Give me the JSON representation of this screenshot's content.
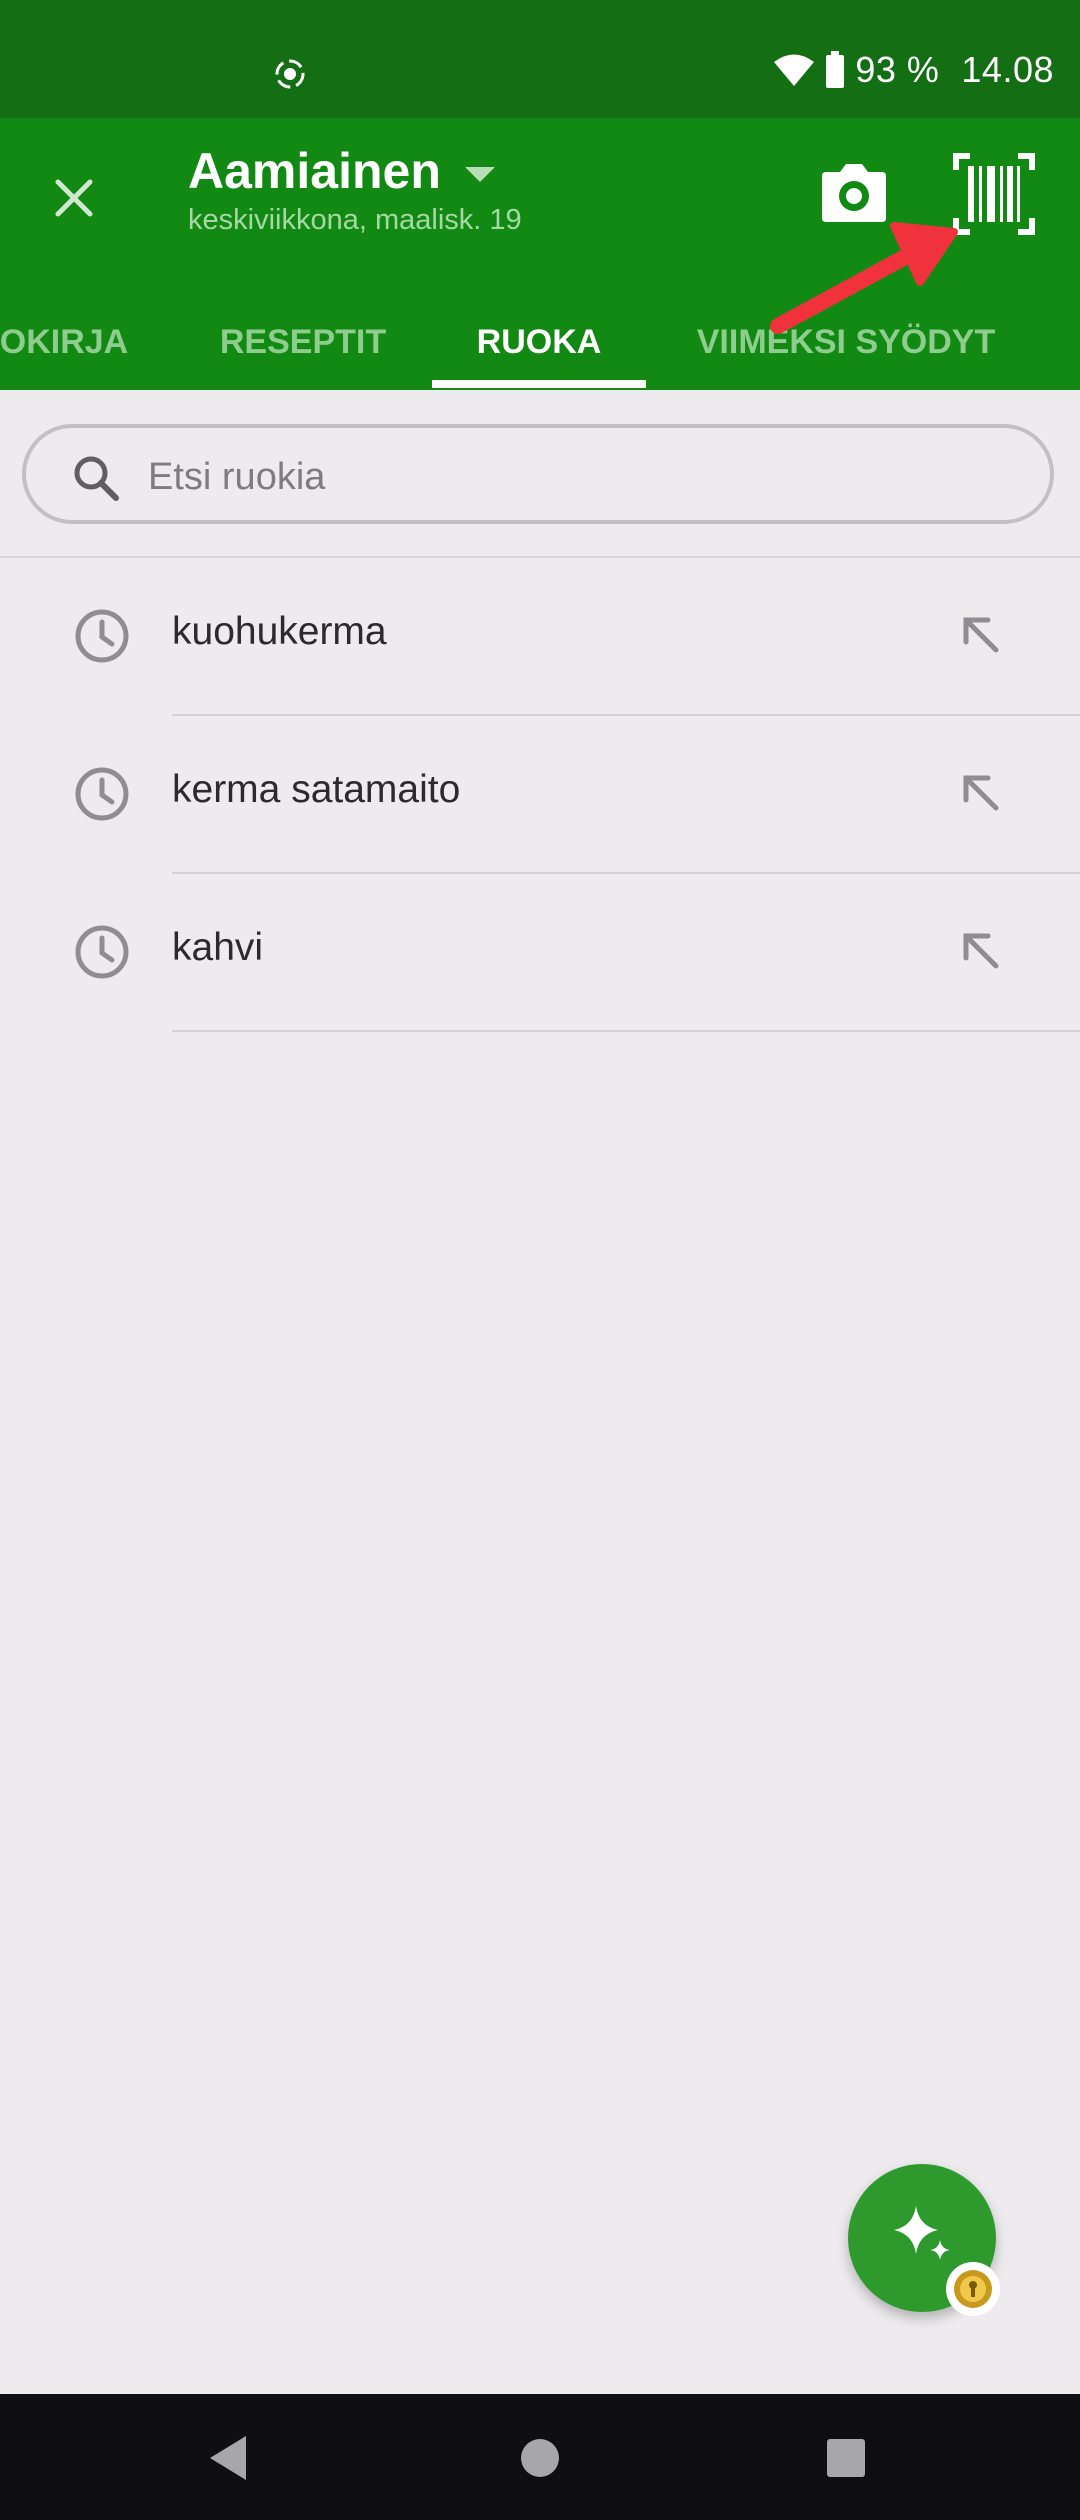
{
  "status_bar": {
    "battery_text": "93 %",
    "time": "14.08",
    "icons": [
      "screen-record-icon",
      "wifi-icon",
      "battery-icon"
    ]
  },
  "app_bar": {
    "title": "Aamiainen",
    "subtitle": "keskiviikkona, maalisk. 19",
    "icons": [
      "close-icon",
      "dropdown-caret-icon",
      "camera-icon",
      "barcode-scanner-icon"
    ]
  },
  "tabs": [
    {
      "label": "OKIRJA",
      "active": false
    },
    {
      "label": "RESEPTIT",
      "active": false
    },
    {
      "label": "RUOKA",
      "active": true
    },
    {
      "label": "VIIMEKSI SYÖDYT",
      "active": false
    }
  ],
  "search": {
    "placeholder": "Etsi ruokia",
    "value": ""
  },
  "recent_items": [
    {
      "label": "kuohukerma"
    },
    {
      "label": "kerma satamaito"
    },
    {
      "label": "kahvi"
    }
  ],
  "colors": {
    "status_bar": "#146e14",
    "app_bar": "#128912",
    "tab_inactive": "#8ecd8e",
    "fab": "#2e9a2e",
    "annotation_arrow": "#f0323c",
    "background": "#edebee",
    "nav_bar": "#0f0e12"
  },
  "fab": {
    "icon": "sparkle-icon",
    "badge_icon": "premium-lock-badge-icon"
  },
  "nav": {
    "icons": [
      "back-icon",
      "home-icon",
      "recents-icon"
    ]
  }
}
